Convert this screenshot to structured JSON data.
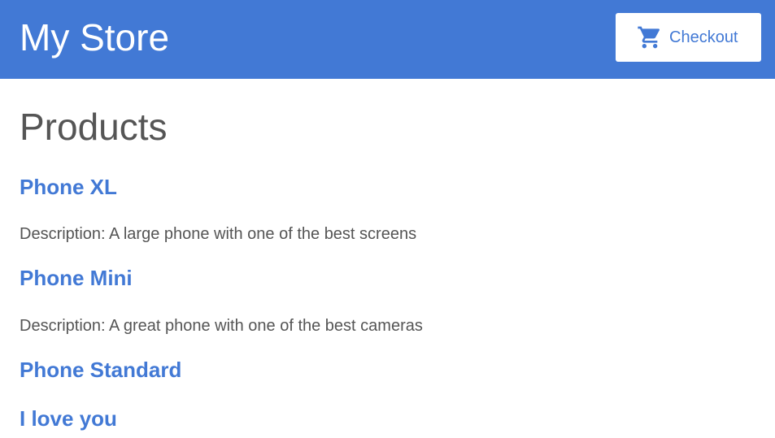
{
  "header": {
    "store_title": "My Store",
    "checkout_label": "Checkout",
    "checkout_icon": "shopping-cart-icon"
  },
  "main": {
    "page_title": "Products",
    "products": [
      {
        "name": "Phone XL",
        "description": "Description: A large phone with one of the best screens"
      },
      {
        "name": "Phone Mini",
        "description": "Description: A great phone with one of the best cameras"
      },
      {
        "name": "Phone Standard",
        "description": ""
      },
      {
        "name": "I love you",
        "description": ""
      }
    ]
  },
  "colors": {
    "brand": "#4279d5",
    "text": "#555555",
    "background": "#ffffff"
  }
}
